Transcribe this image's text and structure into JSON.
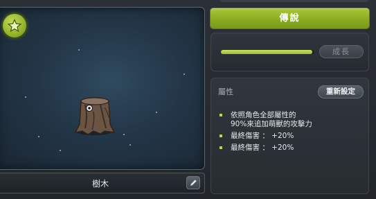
{
  "pet": {
    "name": "樹木"
  },
  "actions": {
    "legend_label": "傳說",
    "grow_label": "成長",
    "growth_progress": 0.98
  },
  "attributes": {
    "title": "屬性",
    "reset_label": "重新設定",
    "items": [
      {
        "lines": [
          "依照角色全部屬性的",
          "90%來追加萌獸的攻擊力"
        ]
      },
      {
        "lines": [
          "最終傷害 ： +20%"
        ]
      },
      {
        "lines": [
          "最終傷害 ： +20%"
        ]
      }
    ]
  },
  "colors": {
    "accent_green": "#9dbc32",
    "bullet": "#b9d84a"
  },
  "icons": {
    "badge": "star-icon",
    "edit": "pencil-icon"
  }
}
